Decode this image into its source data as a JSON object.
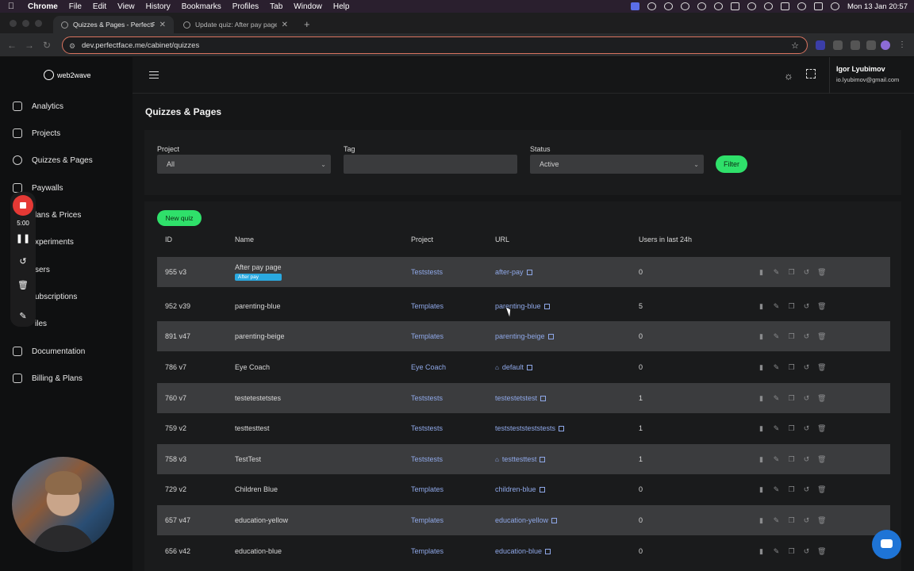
{
  "menubar": {
    "app": "Chrome",
    "items": [
      "File",
      "Edit",
      "View",
      "History",
      "Bookmarks",
      "Profiles",
      "Tab",
      "Window",
      "Help"
    ],
    "clock": "Mon 13 Jan  20:57"
  },
  "tabs": [
    {
      "title": "Quizzes & Pages - PerfectFac"
    },
    {
      "title": "Update quiz: After pay page"
    }
  ],
  "address": {
    "url": "dev.perfectface.me/cabinet/quizzes"
  },
  "sidebar": {
    "logo": "web2wave",
    "items": [
      {
        "label": "Analytics",
        "icon": "chart-icon"
      },
      {
        "label": "Projects",
        "icon": "projects-icon"
      },
      {
        "label": "Quizzes & Pages",
        "icon": "quiz-icon"
      },
      {
        "label": "Paywalls",
        "icon": "paywall-icon"
      },
      {
        "label": "lans & Prices",
        "icon": "plans-icon"
      },
      {
        "label": "xperiments",
        "icon": "experiments-icon"
      },
      {
        "label": "sers",
        "icon": "users-icon"
      },
      {
        "label": "ubscriptions",
        "icon": "subscriptions-icon"
      },
      {
        "label": "iles",
        "icon": "files-icon"
      },
      {
        "label": "Documentation",
        "icon": "doc-icon"
      },
      {
        "label": "Billing & Plans",
        "icon": "billing-icon"
      }
    ]
  },
  "recorder": {
    "time": "5:00"
  },
  "header": {
    "user_name": "Igor Lyubimov",
    "user_email": "io.lyubimov@gmail.com"
  },
  "page": {
    "title": "Quizzes & Pages"
  },
  "filters": {
    "project_label": "Project",
    "project_value": "All",
    "tag_label": "Tag",
    "tag_value": "",
    "status_label": "Status",
    "status_value": "Active",
    "filter_button": "Filter"
  },
  "table": {
    "new_button": "New quiz",
    "columns": [
      "ID",
      "Name",
      "Project",
      "URL",
      "Users in last 24h"
    ],
    "rows": [
      {
        "id": "955 v3",
        "name": "After pay page",
        "badge": "After pay",
        "project": "Teststests",
        "url": "after-pay",
        "home": false,
        "users": "0"
      },
      {
        "id": "952 v39",
        "name": "parenting-blue",
        "badge": "",
        "project": "Templates",
        "url": "parenting-blue",
        "home": false,
        "users": "5"
      },
      {
        "id": "891 v47",
        "name": "parenting-beige",
        "badge": "",
        "project": "Templates",
        "url": "parenting-beige",
        "home": false,
        "users": "0"
      },
      {
        "id": "786 v7",
        "name": "Eye Coach",
        "badge": "",
        "project": "Eye Coach",
        "url": "default",
        "home": true,
        "users": "0"
      },
      {
        "id": "760 v7",
        "name": "testetestetstes",
        "badge": "",
        "project": "Teststests",
        "url": "testestetstest",
        "home": false,
        "users": "1"
      },
      {
        "id": "759 v2",
        "name": "testtesttest",
        "badge": "",
        "project": "Teststests",
        "url": "teststeststeststests",
        "home": false,
        "users": "1"
      },
      {
        "id": "758 v3",
        "name": "TestTest",
        "badge": "",
        "project": "Teststests",
        "url": "testtesttest",
        "home": true,
        "users": "1"
      },
      {
        "id": "729 v2",
        "name": "Children Blue",
        "badge": "",
        "project": "Templates",
        "url": "children-blue",
        "home": false,
        "users": "0"
      },
      {
        "id": "657 v47",
        "name": "education-yellow",
        "badge": "",
        "project": "Templates",
        "url": "education-yellow",
        "home": false,
        "users": "0"
      },
      {
        "id": "656 v42",
        "name": "education-blue",
        "badge": "",
        "project": "Templates",
        "url": "education-blue",
        "home": false,
        "users": "0"
      }
    ]
  }
}
